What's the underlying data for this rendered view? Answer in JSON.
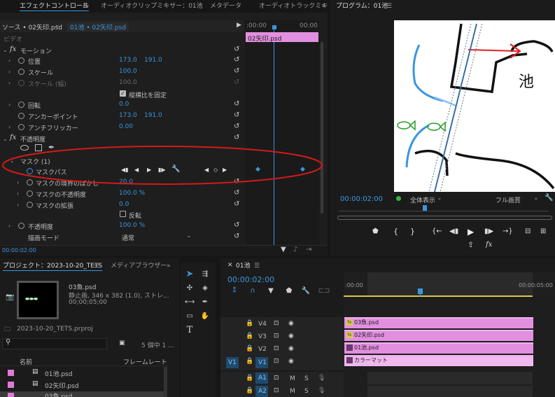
{
  "effect_controls": {
    "tabs": [
      "エフェクトコントロール",
      "オーディオクリップミキサー：01池",
      "メタデータ",
      "オーディオトラックミキ"
    ],
    "source_label": "ソース • 02矢印.psd",
    "sequence_label": "01池 • 02矢印.psd",
    "ruler_left": ":00:00",
    "ruler_right": "00:00",
    "clip_name": "02矢印.psd",
    "section_video": "ビデオ",
    "motion": "モーション",
    "position": "位置",
    "position_x": "173.0",
    "position_y": "191.0",
    "scale": "スケール",
    "scale_value": "100.0",
    "scale_width": "スケール (幅)",
    "scale_width_value": "100.0",
    "uniform_scale": "縦横比を固定",
    "rotation": "回転",
    "rotation_value": "0.0",
    "anchor": "アンカーポイント",
    "anchor_x": "173.0",
    "anchor_y": "191.0",
    "anti_flicker": "アンチフリッカー",
    "anti_flicker_value": "0.00",
    "opacity_section": "不透明度",
    "mask1": "マスク (1)",
    "mask_path": "マスクパス",
    "mask_feather": "マスクの境界のぼかし",
    "mask_feather_value": "20.0",
    "mask_opacity": "マスクの不透明度",
    "mask_opacity_value": "100.0 %",
    "mask_expansion": "マスクの拡張",
    "mask_expansion_value": "0.0",
    "inverted": "反転",
    "opacity": "不透明度",
    "opacity_value": "100.0 %",
    "blend_mode": "描画モード",
    "blend_mode_value": "通常",
    "timecode": "00:00:02:00"
  },
  "program": {
    "tab": "プログラム：01池",
    "timecode": "00:00:02:00",
    "zoom": "全体表示",
    "quality": "フル画質",
    "canvas_text": "池"
  },
  "project": {
    "tabs": [
      "プロジェクト：2023-10-20_TETS",
      "メディアブラウザー"
    ],
    "selected_name": "03魚.psd",
    "selected_info1": "静止画, 346 x 382 (1.0), ストレ...",
    "selected_info2": "00;00;05;00",
    "project_file": "2023-10-20_TETS.prproj",
    "item_count": "5 個中 1 ...",
    "col_name": "名前",
    "col_framerate": "フレームレート",
    "items": [
      "01池.psd",
      "02矢印.psd",
      "03魚.psd"
    ]
  },
  "timeline": {
    "tab": "01池",
    "timecode": "00:00:02:00",
    "ruler_left": ":00:00",
    "ruler_right": "00:00:05:00",
    "tracks": [
      "V4",
      "V3",
      "V2",
      "V1",
      "A1",
      "A2"
    ],
    "source_v1": "V1",
    "source_a1": "A1",
    "clips": [
      "03魚.psd",
      "02矢印.psd",
      "01池.psd",
      "カラーマット"
    ],
    "mute": "M",
    "solo": "S"
  },
  "colors": {
    "accent": "#3a96dd",
    "clip_pink": "#e28fe0",
    "annotation_red": "#d41a1a"
  }
}
